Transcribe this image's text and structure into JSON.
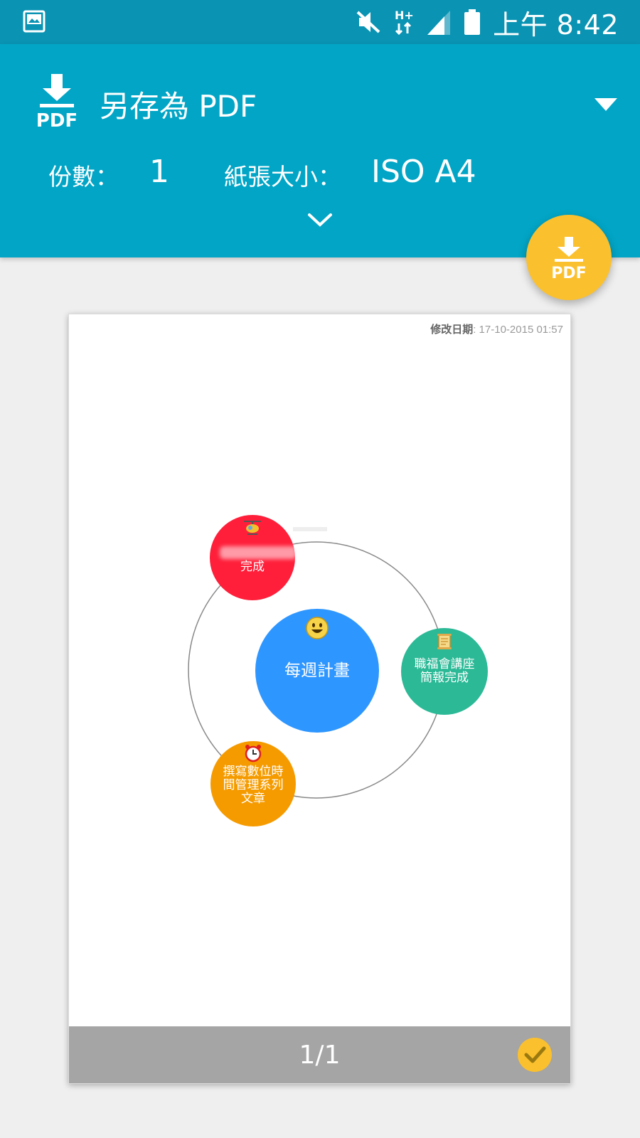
{
  "status_bar": {
    "time": "上午 8:42",
    "icons": [
      "image-notification-icon",
      "mute-icon",
      "hplus-data-icon",
      "signal-icon",
      "battery-icon"
    ]
  },
  "header": {
    "printer_name": "另存為 PDF",
    "copies_label": "份數：",
    "copies_value": "1",
    "paper_label": "紙張大小：",
    "paper_value": "ISO A4",
    "accent_color": "#02a5c6"
  },
  "fab": {
    "label": "PDF",
    "color": "#fbc02d"
  },
  "preview": {
    "modified_label": "修改日期",
    "modified_value": ": 17-10-2015 01:57",
    "center": {
      "label": "每週計畫",
      "color": "#2e96ff"
    },
    "nodes": [
      {
        "label": "完成",
        "color": "#ff1f3a",
        "icon": "helicopter-icon"
      },
      {
        "label_line1": "職福會講座",
        "label_line2": "簡報完成",
        "color": "#2bb996",
        "icon": "scroll-icon"
      },
      {
        "label_line1": "撰寫數位時",
        "label_line2": "間管理系列",
        "label_line3": "文章",
        "color": "#f59b00",
        "icon": "alarm-clock-icon"
      }
    ],
    "page_number": "1/1"
  }
}
